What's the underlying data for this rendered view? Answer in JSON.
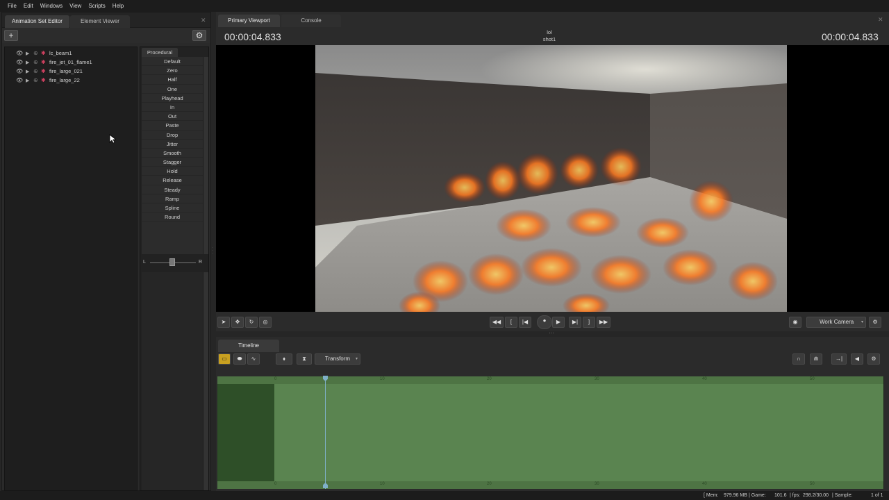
{
  "menu": [
    "File",
    "Edit",
    "Windows",
    "View",
    "Scripts",
    "Help"
  ],
  "left": {
    "tabs": [
      "Animation Set Editor",
      "Element Viewer"
    ],
    "add_label": "+",
    "tree": [
      "lc_beam1",
      "fire_jet_01_flame1",
      "fire_large_021",
      "fire_large_22"
    ],
    "procedural_tab": "Procedural",
    "presets": [
      "Default",
      "Zero",
      "Half",
      "One",
      "Playhead",
      "In",
      "Out",
      "Paste",
      "Drop",
      "Jitter",
      "Smooth",
      "Stagger",
      "Hold",
      "Release",
      "Steady",
      "Ramp",
      "Spline",
      "Round"
    ],
    "slider_left": "L",
    "slider_right": "R"
  },
  "viewport": {
    "tabs": [
      "Primary Viewport",
      "Console"
    ],
    "time_left": "00:00:04.833",
    "time_right": "00:00:04.833",
    "session": "lol",
    "shot": "shot1",
    "camera": "Work Camera"
  },
  "timeline": {
    "tab": "Timeline",
    "mode": "Transform",
    "ruler_top": [
      "0",
      "10",
      "20",
      "30",
      "40",
      "50"
    ],
    "ruler_bottom": [
      "0",
      "10",
      "20",
      "30",
      "40",
      "50"
    ]
  },
  "status": {
    "mem_label": "[ Mem:",
    "mem": "979.96 MB",
    "game_label": "| Game:",
    "game": "101.6",
    "fps_label": "| fps:",
    "fps": "298.2/30.00",
    "sample_label": "| Sample:",
    "page": "1 of 1"
  },
  "colors": {
    "accent": "#5f8c52",
    "track_dark": "#2e4f28",
    "track_light": "#557d4a",
    "playhead": "#7fb0c8"
  }
}
